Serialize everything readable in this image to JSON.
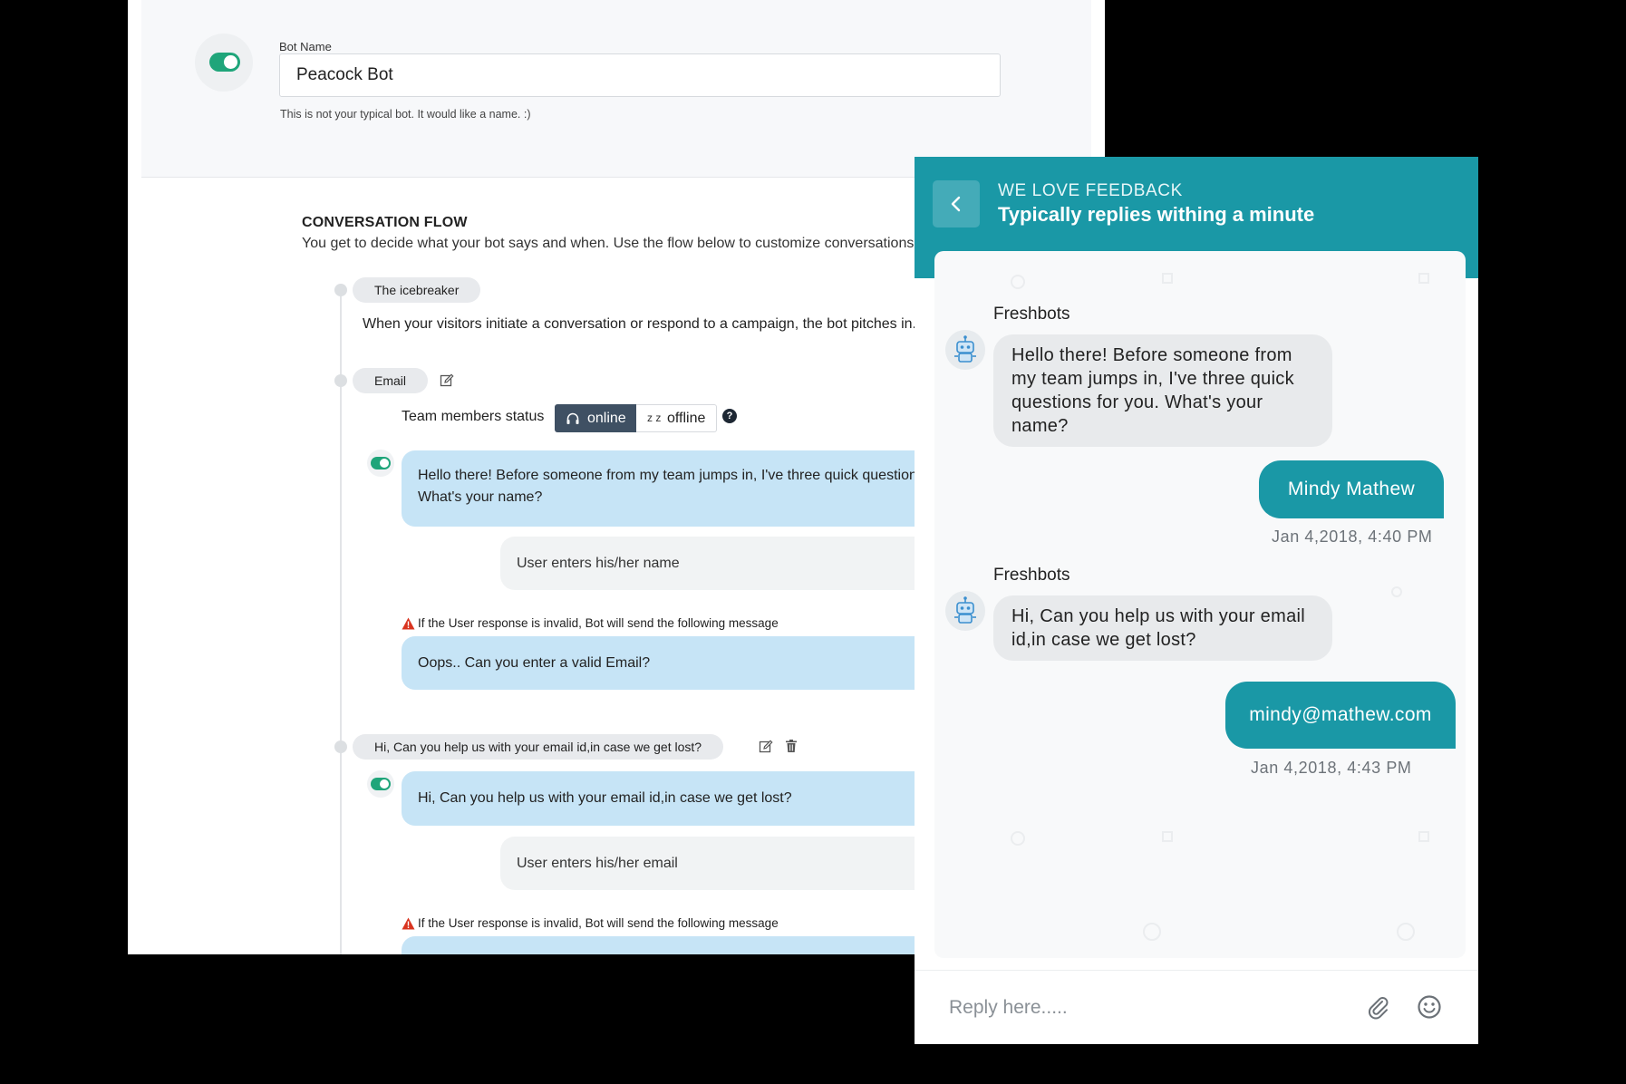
{
  "builder": {
    "bot_name_label": "Bot Name",
    "bot_name_value": "Peacock Bot",
    "bot_name_help": "This is not your typical bot. It would like a name. :)",
    "flow_title": "CONVERSATION FLOW",
    "flow_desc": "You get to decide what your bot says and when. Use the flow below to customize conversations.",
    "steps": [
      {
        "label": "The icebreaker",
        "description": "When your visitors initiate a conversation or respond to a campaign, the bot pitches in."
      },
      {
        "label": "Email",
        "status_label": "Team members status",
        "status_online": "online",
        "status_offline": "offline",
        "status_offline_icon": "z z",
        "bot_message": "Hello there! Before someone from my team jumps in, I've three quick questions for you. What's your name?",
        "user_field": "User enters his/her name",
        "warning": "If the User response is invalid, Bot will send the following message",
        "invalid_message": "Oops.. Can you enter a valid Email?"
      },
      {
        "label": "Hi, Can you help us with your email id,in case we get lost?",
        "bot_message": "Hi, Can you help us with your email id,in case we get lost?",
        "user_field": "User enters his/her email",
        "warning": "If the User response is invalid, Bot will send the following message"
      }
    ]
  },
  "chat": {
    "title": "WE LOVE FEEDBACK",
    "subtitle": "Typically replies withing a minute",
    "messages": [
      {
        "sender": "Freshbots",
        "text": "Hello there! Before someone from my team jumps in, I've three quick questions for you. What's your name?"
      },
      {
        "reply": "Mindy Mathew",
        "time": "Jan 4,2018, 4:40 PM"
      },
      {
        "sender": "Freshbots",
        "text": "Hi, Can you help us with your email id,in case we get lost?"
      },
      {
        "reply": "mindy@mathew.com",
        "time": "Jan 4,2018, 4:43 PM"
      }
    ],
    "reply_placeholder": "Reply here.....",
    "accent_color": "#1a98a6"
  },
  "icons": [
    "toggle-icon",
    "edit-icon",
    "trash-icon",
    "headset-icon",
    "help-icon",
    "lock-icon",
    "warning-icon",
    "user-avatar-icon",
    "back-icon",
    "bot-icon",
    "attach-icon",
    "emoji-icon"
  ]
}
